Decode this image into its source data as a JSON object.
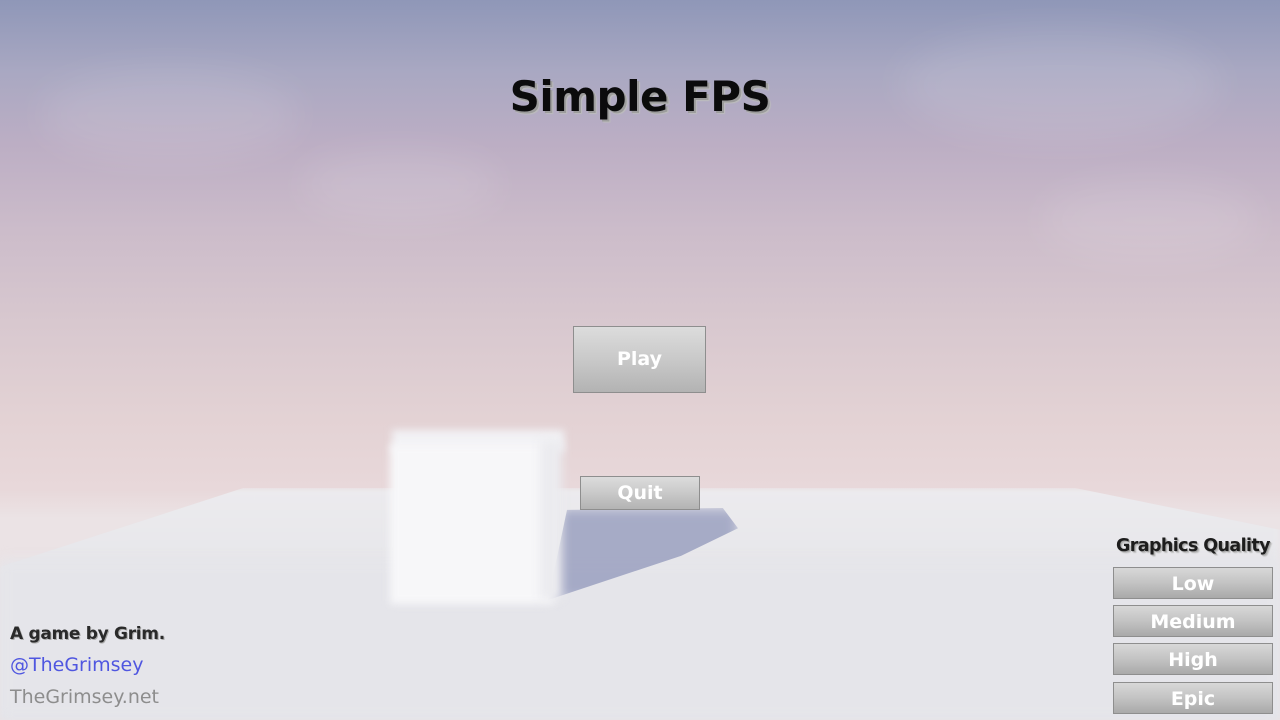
{
  "title": "Simple FPS",
  "menu": {
    "play_label": "Play",
    "quit_label": "Quit"
  },
  "graphics_quality": {
    "heading": "Graphics Quality",
    "options": [
      "Low",
      "Medium",
      "High",
      "Epic"
    ]
  },
  "credits": {
    "byline": "A game by Grim.",
    "twitter": "@TheGrimsey",
    "website": "TheGrimsey.net"
  },
  "colors": {
    "twitter_link": "#4f56e0",
    "website_link": "#8d8d8d",
    "button_text": "#ffffff"
  }
}
